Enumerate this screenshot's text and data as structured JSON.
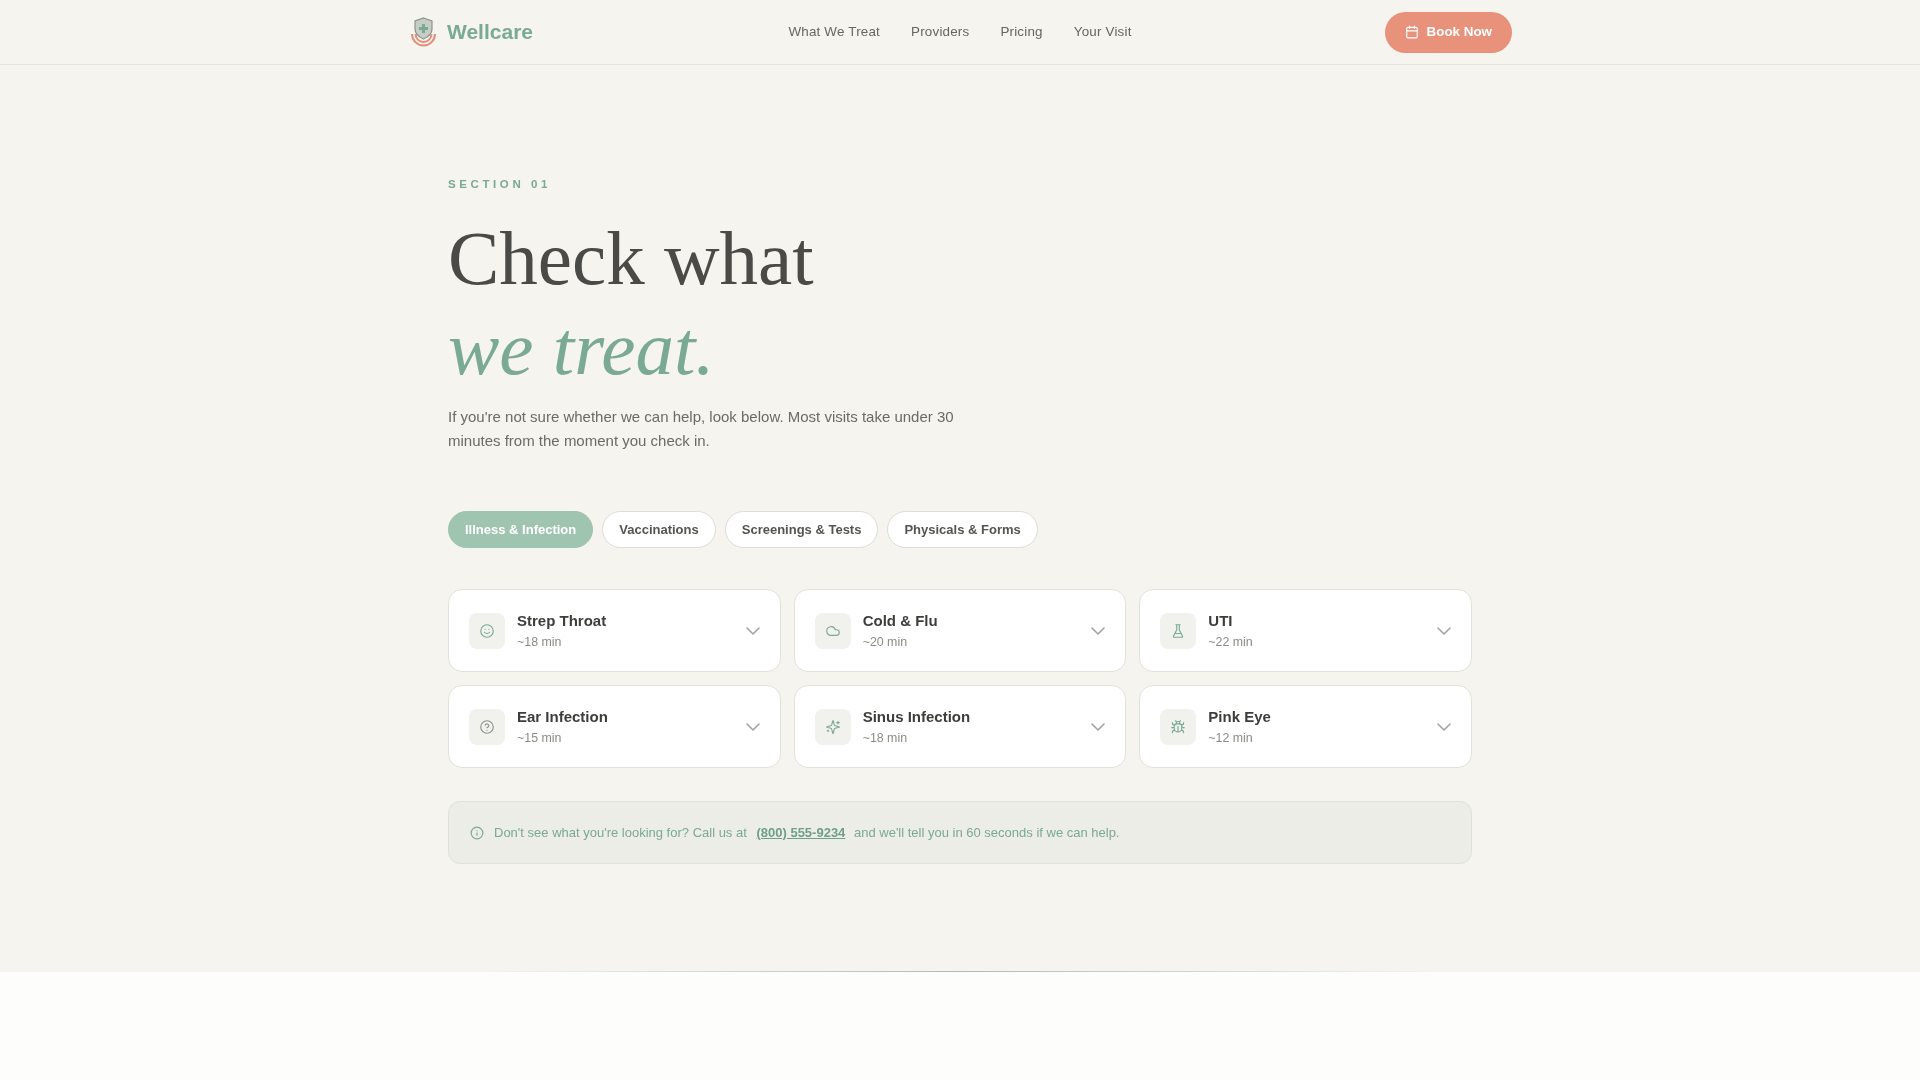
{
  "header": {
    "brand": "Wellcare",
    "nav": [
      {
        "label": "What We Treat"
      },
      {
        "label": "Providers"
      },
      {
        "label": "Pricing"
      },
      {
        "label": "Your Visit"
      }
    ],
    "cta": "Book Now"
  },
  "hero": {
    "eyebrow": "SECTION 01",
    "title_line_1": "Check what",
    "title_line_2": "we treat.",
    "intro": "If you're not sure whether we can help, look below. Most visits take under 30 minutes from the moment you check in."
  },
  "tabs": [
    {
      "label": "Illness & Infection",
      "selected": true
    },
    {
      "label": "Vaccinations",
      "selected": false
    },
    {
      "label": "Screenings & Tests",
      "selected": false
    },
    {
      "label": "Physicals & Forms",
      "selected": false
    }
  ],
  "conditions": [
    {
      "name": "Strep Throat",
      "time": "~18 min"
    },
    {
      "name": "Cold & Flu",
      "time": "~20 min"
    },
    {
      "name": "UTI",
      "time": "~22 min"
    },
    {
      "name": "Ear Infection",
      "time": "~15 min"
    },
    {
      "name": "Sinus Infection",
      "time": "~18 min"
    },
    {
      "name": "Pink Eye",
      "time": "~12 min"
    }
  ],
  "notice": {
    "text_before": "Don't see what you're looking for? Call us at",
    "phone": "(800) 555-9234",
    "text_after": "and we'll tell you in 60 seconds if we can help."
  }
}
